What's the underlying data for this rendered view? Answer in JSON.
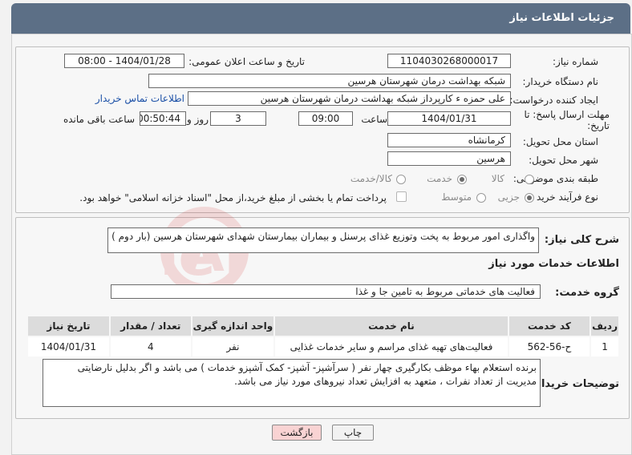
{
  "header": {
    "title": "جزئیات اطلاعات نیاز"
  },
  "form": {
    "need_number_label": "شماره نیاز:",
    "need_number": "1104030268000017",
    "announce_label": "تاریخ و ساعت اعلان عمومی:",
    "announce_value": "1404/01/28 - 08:00",
    "buyer_org_label": "نام دستگاه خریدار:",
    "buyer_org": "شبکه بهداشت درمان شهرستان هرسین",
    "creator_label": "ایجاد کننده درخواست:",
    "creator": "علی حمزه ء کارپرداز شبکه بهداشت درمان شهرستان هرسین",
    "contact_link": "اطلاعات تماس خریدار",
    "deadline_label": "مهلت ارسال پاسخ: تا تاریخ:",
    "deadline_date": "1404/01/31",
    "hour_label": "ساعت",
    "deadline_hour": "09:00",
    "days_value": "3",
    "days_label": "روز و",
    "remaining_time": "00:50:44",
    "remaining_label": "ساعت باقی مانده",
    "province_label": "استان محل تحویل:",
    "province": "کرمانشاه",
    "city_label": "شهر محل تحویل:",
    "city": "هرسین",
    "category_label": "طبقه بندی موضوعی:",
    "category_options": [
      "کالا",
      "خدمت",
      "کالا/خدمت"
    ],
    "category_selected": "خدمت",
    "process_label": "نوع فرآیند خرید :",
    "process_options": [
      "جزیی",
      "متوسط"
    ],
    "process_selected": "جزیی",
    "payment_note": "پرداخت تمام یا بخشی از مبلغ خرید،از محل \"اسناد خزانه اسلامی\" خواهد بود."
  },
  "summary": {
    "label": "شرح کلی نیاز:",
    "text": "واگذاری امور مربوط به پخت وتوزیع غذای پرسنل و بیماران بیمارستان شهدای شهرستان هرسین (بار دوم )"
  },
  "services": {
    "section_title": "اطلاعات خدمات مورد نیاز",
    "group_label": "گروه خدمت:",
    "group_value": "فعالیت های خدماتی مربوط به تامین جا و غذا",
    "columns": [
      "ردیف",
      "کد خدمت",
      "نام خدمت",
      "واحد اندازه گیری",
      "تعداد / مقدار",
      "تاریخ نیاز"
    ],
    "rows": [
      {
        "row": "1",
        "code": "ح-56-562",
        "name": "فعالیت‌های تهیه غذای مراسم و سایر خدمات غذایی",
        "unit": "نفر",
        "qty": "4",
        "date": "1404/01/31"
      }
    ]
  },
  "buyer_notes": {
    "label": "توضیحات خریدار:",
    "text": "برنده استعلام بهاء موظف بکارگیری چهار نفر ( سرآشپز- آشپز- کمک آشپزو خدمات ) می باشد و اگر بدلیل نارضایتی مدیریت از تعداد نفرات ، متعهد به افزایش تعداد نیروهای مورد نیاز می باشد."
  },
  "buttons": {
    "print": "چاپ",
    "back": "بازگشت"
  },
  "colors": {
    "header_bg": "#5c6f86",
    "back_btn_bg": "#f9d3d3",
    "print_btn_bg": "#f2f2f2",
    "link": "#1a4fa6"
  },
  "watermark": {
    "text": "AriaTender.neT"
  }
}
